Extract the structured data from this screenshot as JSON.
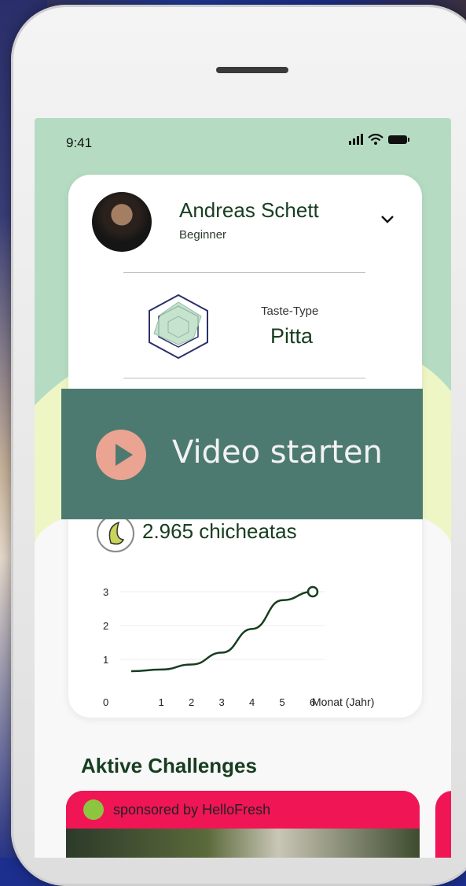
{
  "status": {
    "time": "9:41"
  },
  "profile": {
    "name": "Andreas Schett",
    "level": "Beginner"
  },
  "taste": {
    "label": "Taste-Type",
    "value": "Pitta"
  },
  "coins": {
    "amount": "2.965 chicheatas"
  },
  "chart_data": {
    "type": "line",
    "x": [
      0,
      1,
      2,
      3,
      4,
      5,
      6
    ],
    "x_ticks": [
      "0",
      "1",
      "2",
      "3",
      "4",
      "5",
      "6"
    ],
    "y_ticks": [
      "1",
      "2",
      "3"
    ],
    "xlabel": "Monat (Jahr)",
    "ylabel": "",
    "series": [
      {
        "values": [
          0.65,
          0.7,
          0.85,
          1.2,
          1.9,
          2.75,
          3.0
        ]
      }
    ],
    "ylim": [
      0,
      3.3
    ],
    "grid": true
  },
  "video": {
    "label": "Video starten"
  },
  "challenges": {
    "title": "Aktive Challenges",
    "sponsor": "sponsored by HelloFresh"
  },
  "colors": {
    "accent": "#f01656",
    "green": "#b5dcc2",
    "overlay": "#4d7a70",
    "play": "#eaa491"
  }
}
